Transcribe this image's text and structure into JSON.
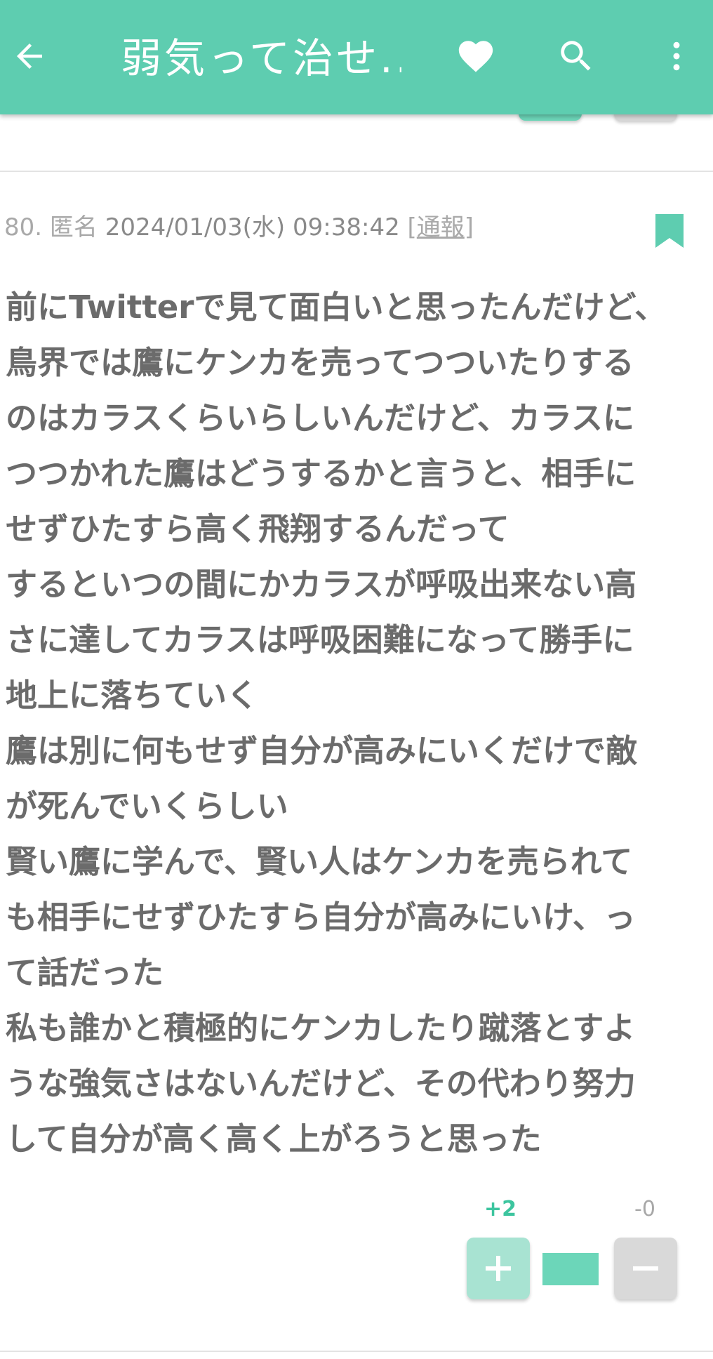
{
  "appbar": {
    "title": "弱気って治せ...",
    "back_icon": "arrow-left-icon",
    "favorite_icon": "heart-icon",
    "search_icon": "search-icon",
    "menu_icon": "more-vertical-icon",
    "background_color": "#5ecdb0"
  },
  "post": {
    "number": "80.",
    "author": "匿名",
    "datetime": "2024/01/03(水) 09:38:42",
    "report_open": "[",
    "report_label": "通報",
    "report_close": "]",
    "bookmark_icon": "bookmark-icon",
    "body_lines": [
      "前にTwitterで見て面白いと思ったんだけど、",
      "鳥界では鷹にケンカを売ってつついたりする",
      "のはカラスくらいらしいんだけど、カラスに",
      "つつかれた鷹はどうするかと言うと、相手に",
      "せずひたすら高く飛翔するんだって",
      "するといつの間にかカラスが呼吸出来ない高",
      "さに達してカラスは呼吸困難になって勝手に",
      "地上に落ちていく",
      "鷹は別に何もせず自分が高みにいくだけで敵",
      "が死んでいくらしい",
      "賢い鷹に学んで、賢い人はケンカを売られて",
      "も相手にせずひたすら自分が高みにいけ、っ",
      "て話だった",
      "私も誰かと積極的にケンカしたり蹴落とすよ",
      "うな強気さはないんだけど、その代わり努力",
      "して自分が高く高く上がろうと思った"
    ],
    "votes": {
      "plus_count": "+2",
      "minus_count": "-0",
      "plus_icon": "plus-icon",
      "minus_icon": "minus-icon",
      "plus_color": "#3dc59f"
    }
  }
}
